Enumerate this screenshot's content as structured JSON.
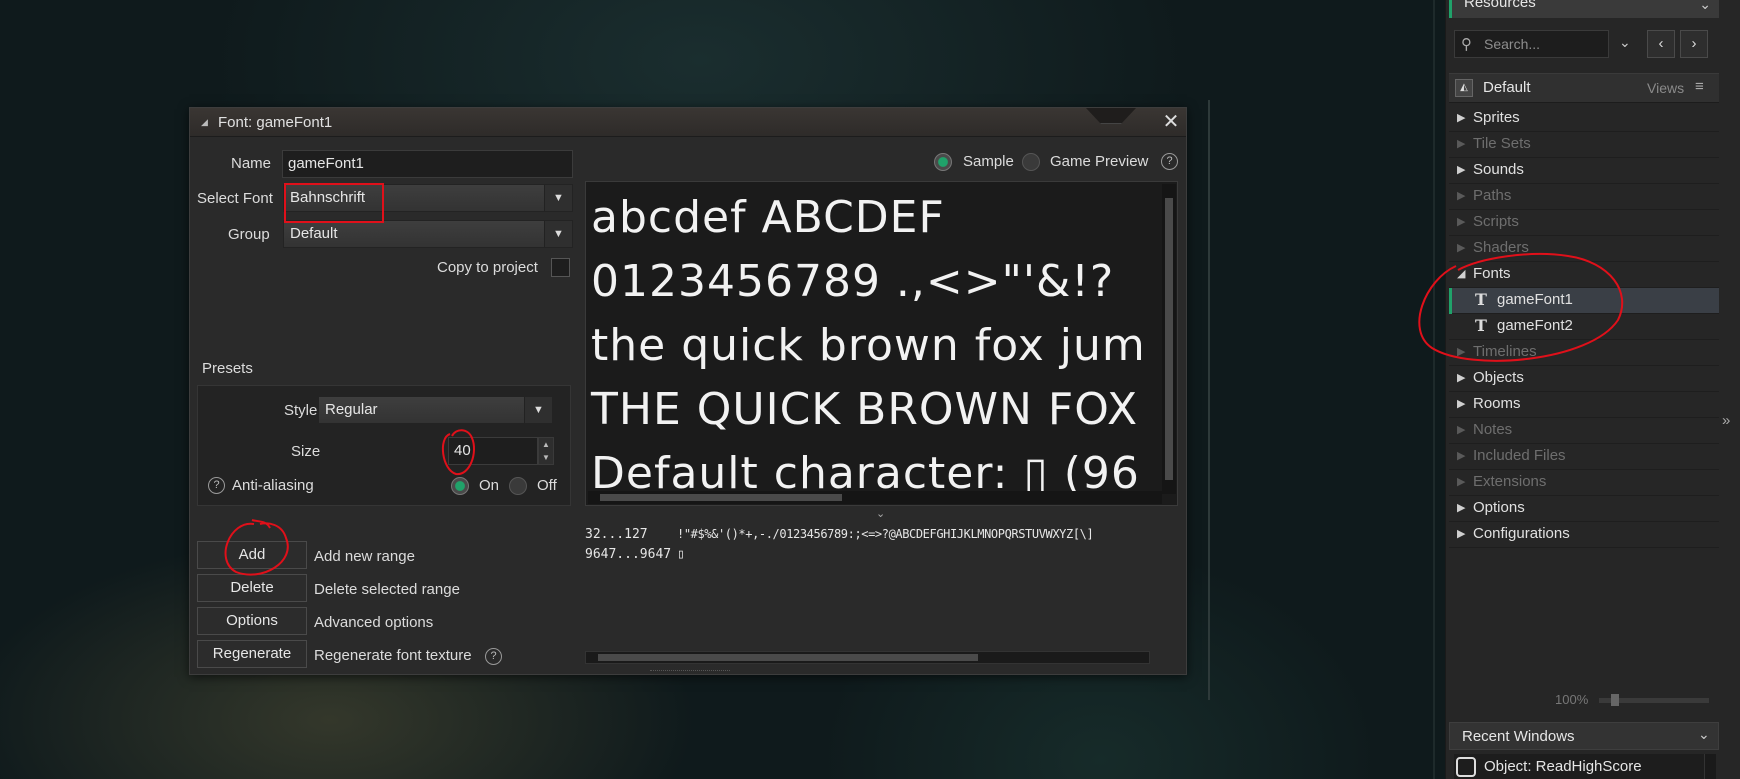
{
  "editor": {
    "title": "Font: gameFont1",
    "name_label": "Name",
    "name_value": "gameFont1",
    "select_font_label": "Select Font",
    "select_font_value": "Bahnschrift",
    "group_label": "Group",
    "group_value": "Default",
    "copy_label": "Copy to project",
    "presets_label": "Presets",
    "style_label": "Style",
    "style_value": "Regular",
    "size_label": "Size",
    "size_value": "40",
    "antialias_label": "Anti-aliasing",
    "on_label": "On",
    "off_label": "Off",
    "buttons": [
      {
        "label": "Add",
        "desc": "Add new range"
      },
      {
        "label": "Delete",
        "desc": "Delete selected range"
      },
      {
        "label": "Options",
        "desc": "Advanced options"
      },
      {
        "label": "Regenerate",
        "desc": "Regenerate font texture"
      }
    ],
    "sample_label": "Sample",
    "game_preview_label": "Game Preview",
    "sample_lines": [
      "abcdef ABCDEF",
      "0123456789 .,<>\"'&!?",
      "the quick brown fox jum",
      "THE QUICK BROWN FOX",
      "Default character: ▯ (96"
    ],
    "ranges": [
      {
        "range": "32...127",
        "chars": "!\"#$%&'()*+,-./0123456789:;<=>?@ABCDEFGHIJKLMNOPQRSTUVWXYZ[\\]"
      },
      {
        "range": "9647...9647",
        "chars": "▯"
      }
    ]
  },
  "resources": {
    "title": "Resources",
    "search_placeholder": "Search...",
    "default_label": "Default",
    "views_label": "Views",
    "items": [
      {
        "label": "Sprites",
        "active": true
      },
      {
        "label": "Tile Sets",
        "active": false
      },
      {
        "label": "Sounds",
        "active": true
      },
      {
        "label": "Paths",
        "active": false
      },
      {
        "label": "Scripts",
        "active": false
      },
      {
        "label": "Shaders",
        "active": false
      },
      {
        "label": "Fonts",
        "active": true,
        "expanded": true
      },
      {
        "label": "gameFont1",
        "child": true
      },
      {
        "label": "gameFont2",
        "child": true
      },
      {
        "label": "Timelines",
        "active": false
      },
      {
        "label": "Objects",
        "active": true
      },
      {
        "label": "Rooms",
        "active": true
      },
      {
        "label": "Notes",
        "active": false
      },
      {
        "label": "Included Files",
        "active": false
      },
      {
        "label": "Extensions",
        "active": false
      },
      {
        "label": "Options",
        "active": true
      },
      {
        "label": "Configurations",
        "active": true
      }
    ],
    "zoom": "100%",
    "recent_title": "Recent Windows",
    "recent_item": "Object: ReadHighScore"
  },
  "colors": {
    "accent": "#20a26a",
    "annotation": "#e0101a"
  }
}
